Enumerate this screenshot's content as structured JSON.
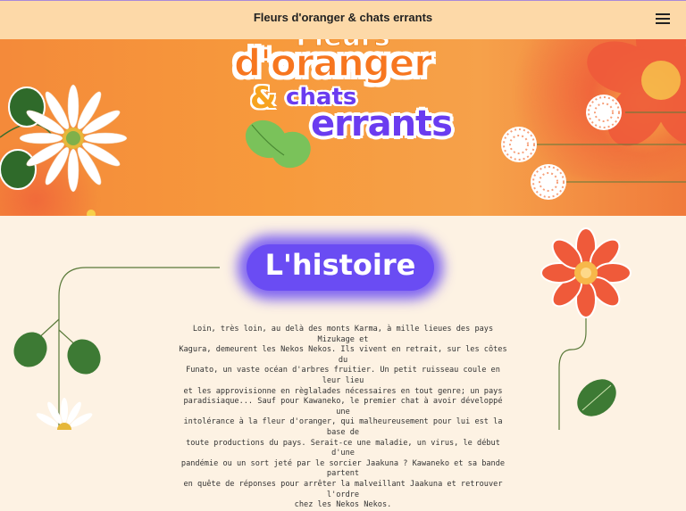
{
  "header": {
    "title": "Fleurs d'oranger & chats errants",
    "menu_icon": "hamburger-menu-icon"
  },
  "hero": {
    "logo_line1": "Fleurs",
    "logo_line2": "d'oranger",
    "logo_amp": "&",
    "logo_line3": "chats",
    "logo_line4": "errants"
  },
  "section": {
    "title": "L'histoire",
    "paragraph_lines": [
      "Loin, très loin, au delà des monts Karma, à mille lieues des pays Mizukage et",
      "Kagura, demeurent les Nekos Nekos. Ils vivent en retrait, sur les côtes du",
      "Funato, un vaste océan d'arbres fruitier. Un petit ruisseau coule en leur lieu",
      "et les approvisionne en règlalades nécessaires en tout genre; un pays",
      "paradisiaque... Sauf pour Kawaneko, le premier chat à avoir développé une",
      "intolérance à la fleur d'oranger, qui malheureusement pour lui est la base de",
      "toute productions du pays. Serait-ce une maladie, un virus, le début d'une",
      "pandémie ou un sort jeté par le sorcier Jaakuna ? Kawaneko et sa bande partent",
      "en quête de réponses pour arrêter la malveillant Jaakuna et retrouver l'ordre",
      "chez les Nekos Nekos."
    ]
  },
  "colors": {
    "header_bg": "#fdd9a8",
    "page_bg": "#fdf2e3",
    "hero_orange": "#f48a3a",
    "title_purple": "#6a4cf3",
    "leaf_green": "#3d7a34"
  }
}
